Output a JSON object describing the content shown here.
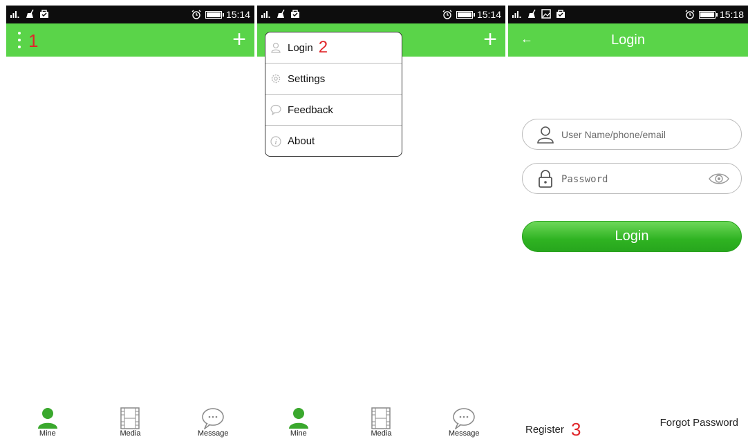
{
  "colors": {
    "appbar": "#5ad449",
    "statusbar": "#0d0d0d",
    "annotation": "#e0262a",
    "tab_active": "#3aa82d"
  },
  "screens": [
    {
      "status_time": "15:14",
      "annotation": "1",
      "tabs": [
        {
          "label": "Mine",
          "icon": "person-icon"
        },
        {
          "label": "Media",
          "icon": "film-icon"
        },
        {
          "label": "Message",
          "icon": "chat-bubble-icon"
        }
      ]
    },
    {
      "status_time": "15:14",
      "annotation": "2",
      "menu": [
        {
          "label": "Login",
          "icon": "user-outline-icon"
        },
        {
          "label": "Settings",
          "icon": "gear-icon"
        },
        {
          "label": "Feedback",
          "icon": "chat-bubble-icon"
        },
        {
          "label": "About",
          "icon": "info-icon"
        }
      ],
      "tabs": [
        {
          "label": "Mine",
          "icon": "person-icon"
        },
        {
          "label": "Media",
          "icon": "film-icon"
        },
        {
          "label": "Message",
          "icon": "chat-bubble-icon"
        }
      ]
    },
    {
      "status_time": "15:18",
      "title": "Login",
      "username_placeholder": "User Name/phone/email",
      "password_placeholder": "Password",
      "login_button": "Login",
      "register_link": "Register",
      "annotation": "3",
      "forgot_link": "Forgot Password"
    }
  ]
}
